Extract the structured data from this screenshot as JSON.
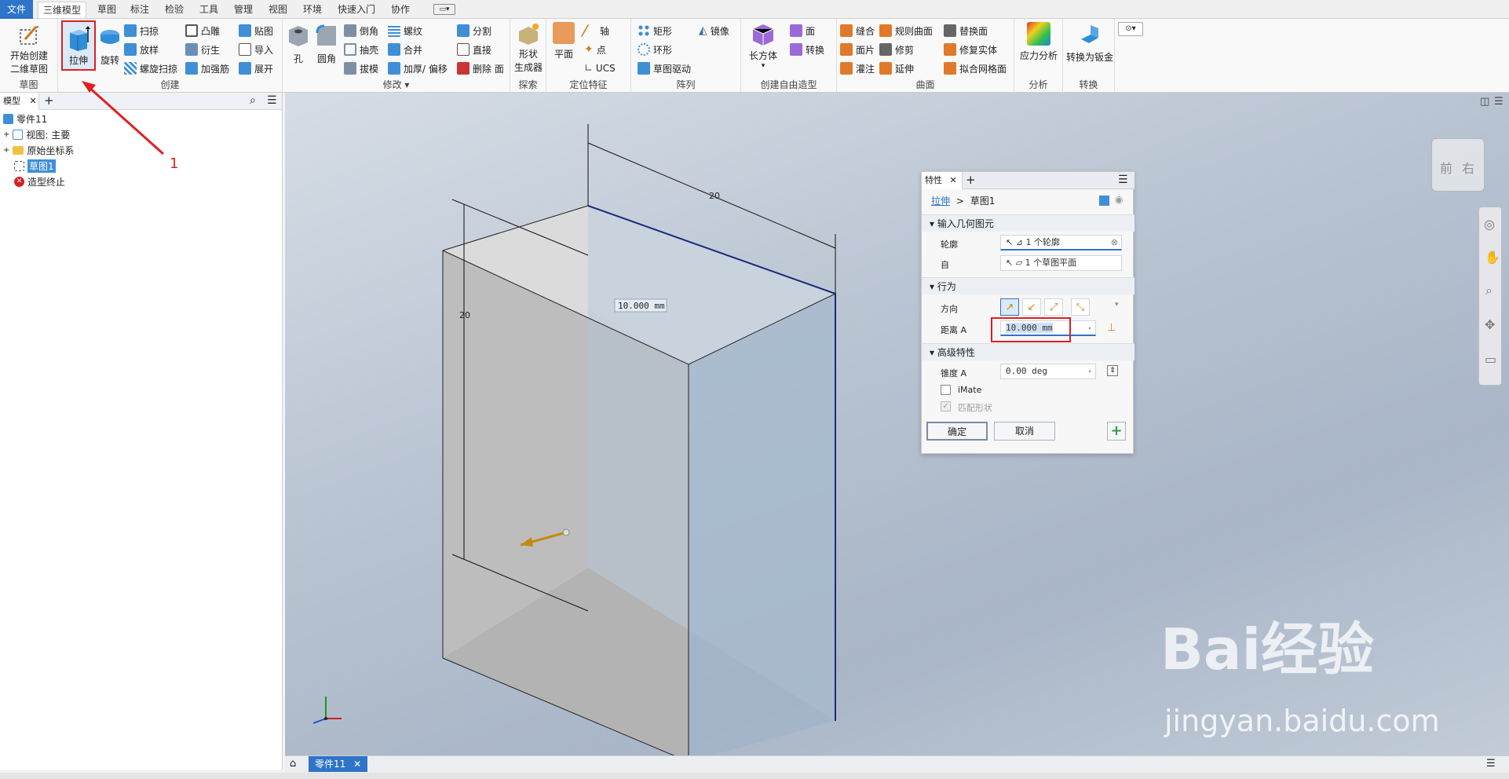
{
  "tabs": [
    "文件",
    "三维模型",
    "草图",
    "标注",
    "检验",
    "工具",
    "管理",
    "视图",
    "环境",
    "快速入门",
    "协作"
  ],
  "ribbon": {
    "sketch_group": {
      "start_sketch_line1": "开始创建",
      "start_sketch_line2": "二维草图",
      "label": "草图"
    },
    "create_group": {
      "extrude": "拉伸",
      "revolve": "旋转",
      "sweep": "扫掠",
      "loft": "放样",
      "coil": "螺旋扫掠",
      "emboss": "凸雕",
      "derive": "衍生",
      "rib": "加强筋",
      "decal": "贴图",
      "import": "导入",
      "unfold": "展开",
      "label": "创建"
    },
    "modify_group": {
      "hole": "孔",
      "fillet": "圆角",
      "chamfer": "倒角",
      "shell": "抽壳",
      "draft": "拔模",
      "thread": "螺纹",
      "combine": "合并",
      "thicken": "加厚/ 偏移",
      "split": "分割",
      "direct": "直接",
      "delete_face": "删除 面",
      "label": "修改"
    },
    "explore_group": {
      "shape_gen_line1": "形状",
      "shape_gen_line2": "生成器",
      "label": "探索"
    },
    "workfeature_group": {
      "plane": "平面",
      "axis": "轴",
      "point": "点",
      "ucs": "UCS",
      "label": "定位特征"
    },
    "pattern_group": {
      "rect": "矩形",
      "circular": "环形",
      "sketch_driven": "草图驱动",
      "mirror": "镜像",
      "label": "阵列"
    },
    "freeform_group": {
      "box": "长方体",
      "face": "面",
      "convert": "转换",
      "label": "创建自由造型"
    },
    "surface_group": {
      "stitch": "缝合",
      "patch": "面片",
      "sculpt": "灌注",
      "ruled": "规则曲面",
      "trim": "修剪",
      "extend": "延伸",
      "replace": "替换面",
      "repair": "修复实体",
      "fit_mesh": "拟合网格面",
      "label": "曲面"
    },
    "analysis_group": {
      "stress": "应力分析",
      "label": "分析"
    },
    "convert_group": {
      "sheetmetal": "转换为钣金",
      "label": "转换"
    }
  },
  "annotation": {
    "number": "1"
  },
  "browser": {
    "tab": "模型",
    "items": [
      "零件11",
      "视图: 主要",
      "原始坐标系",
      "草图1",
      "造型终止"
    ]
  },
  "viewport": {
    "dim_top": "20",
    "dim_left": "20",
    "dim_distance": "10.000 mm",
    "viewcube_front": "前",
    "viewcube_right": "右"
  },
  "properties": {
    "tab": "特性",
    "breadcrumb_op": "拉伸",
    "breadcrumb_sep": ">",
    "breadcrumb_sketch": "草图1",
    "section_input": "输入几何图元",
    "profile_label": "轮廓",
    "profile_value": "1 个轮廓",
    "from_label": "自",
    "from_value": "1 个草图平面",
    "section_behavior": "行为",
    "direction_label": "方向",
    "distance_label": "距离 A",
    "distance_value": "10.000 mm",
    "section_advanced": "高级特性",
    "taper_label": "锥度 A",
    "taper_value": "0.00 deg",
    "imate_label": "iMate",
    "match_label": "匹配形状",
    "ok": "确定",
    "cancel": "取消"
  },
  "bottom_tab": "零件11",
  "watermark": {
    "brand": "Bai经验",
    "url": "jingyan.baidu.com"
  },
  "colors": {
    "accent": "#2e74c8",
    "highlight_red": "#e02020",
    "ok_green": "#2f9e44"
  }
}
